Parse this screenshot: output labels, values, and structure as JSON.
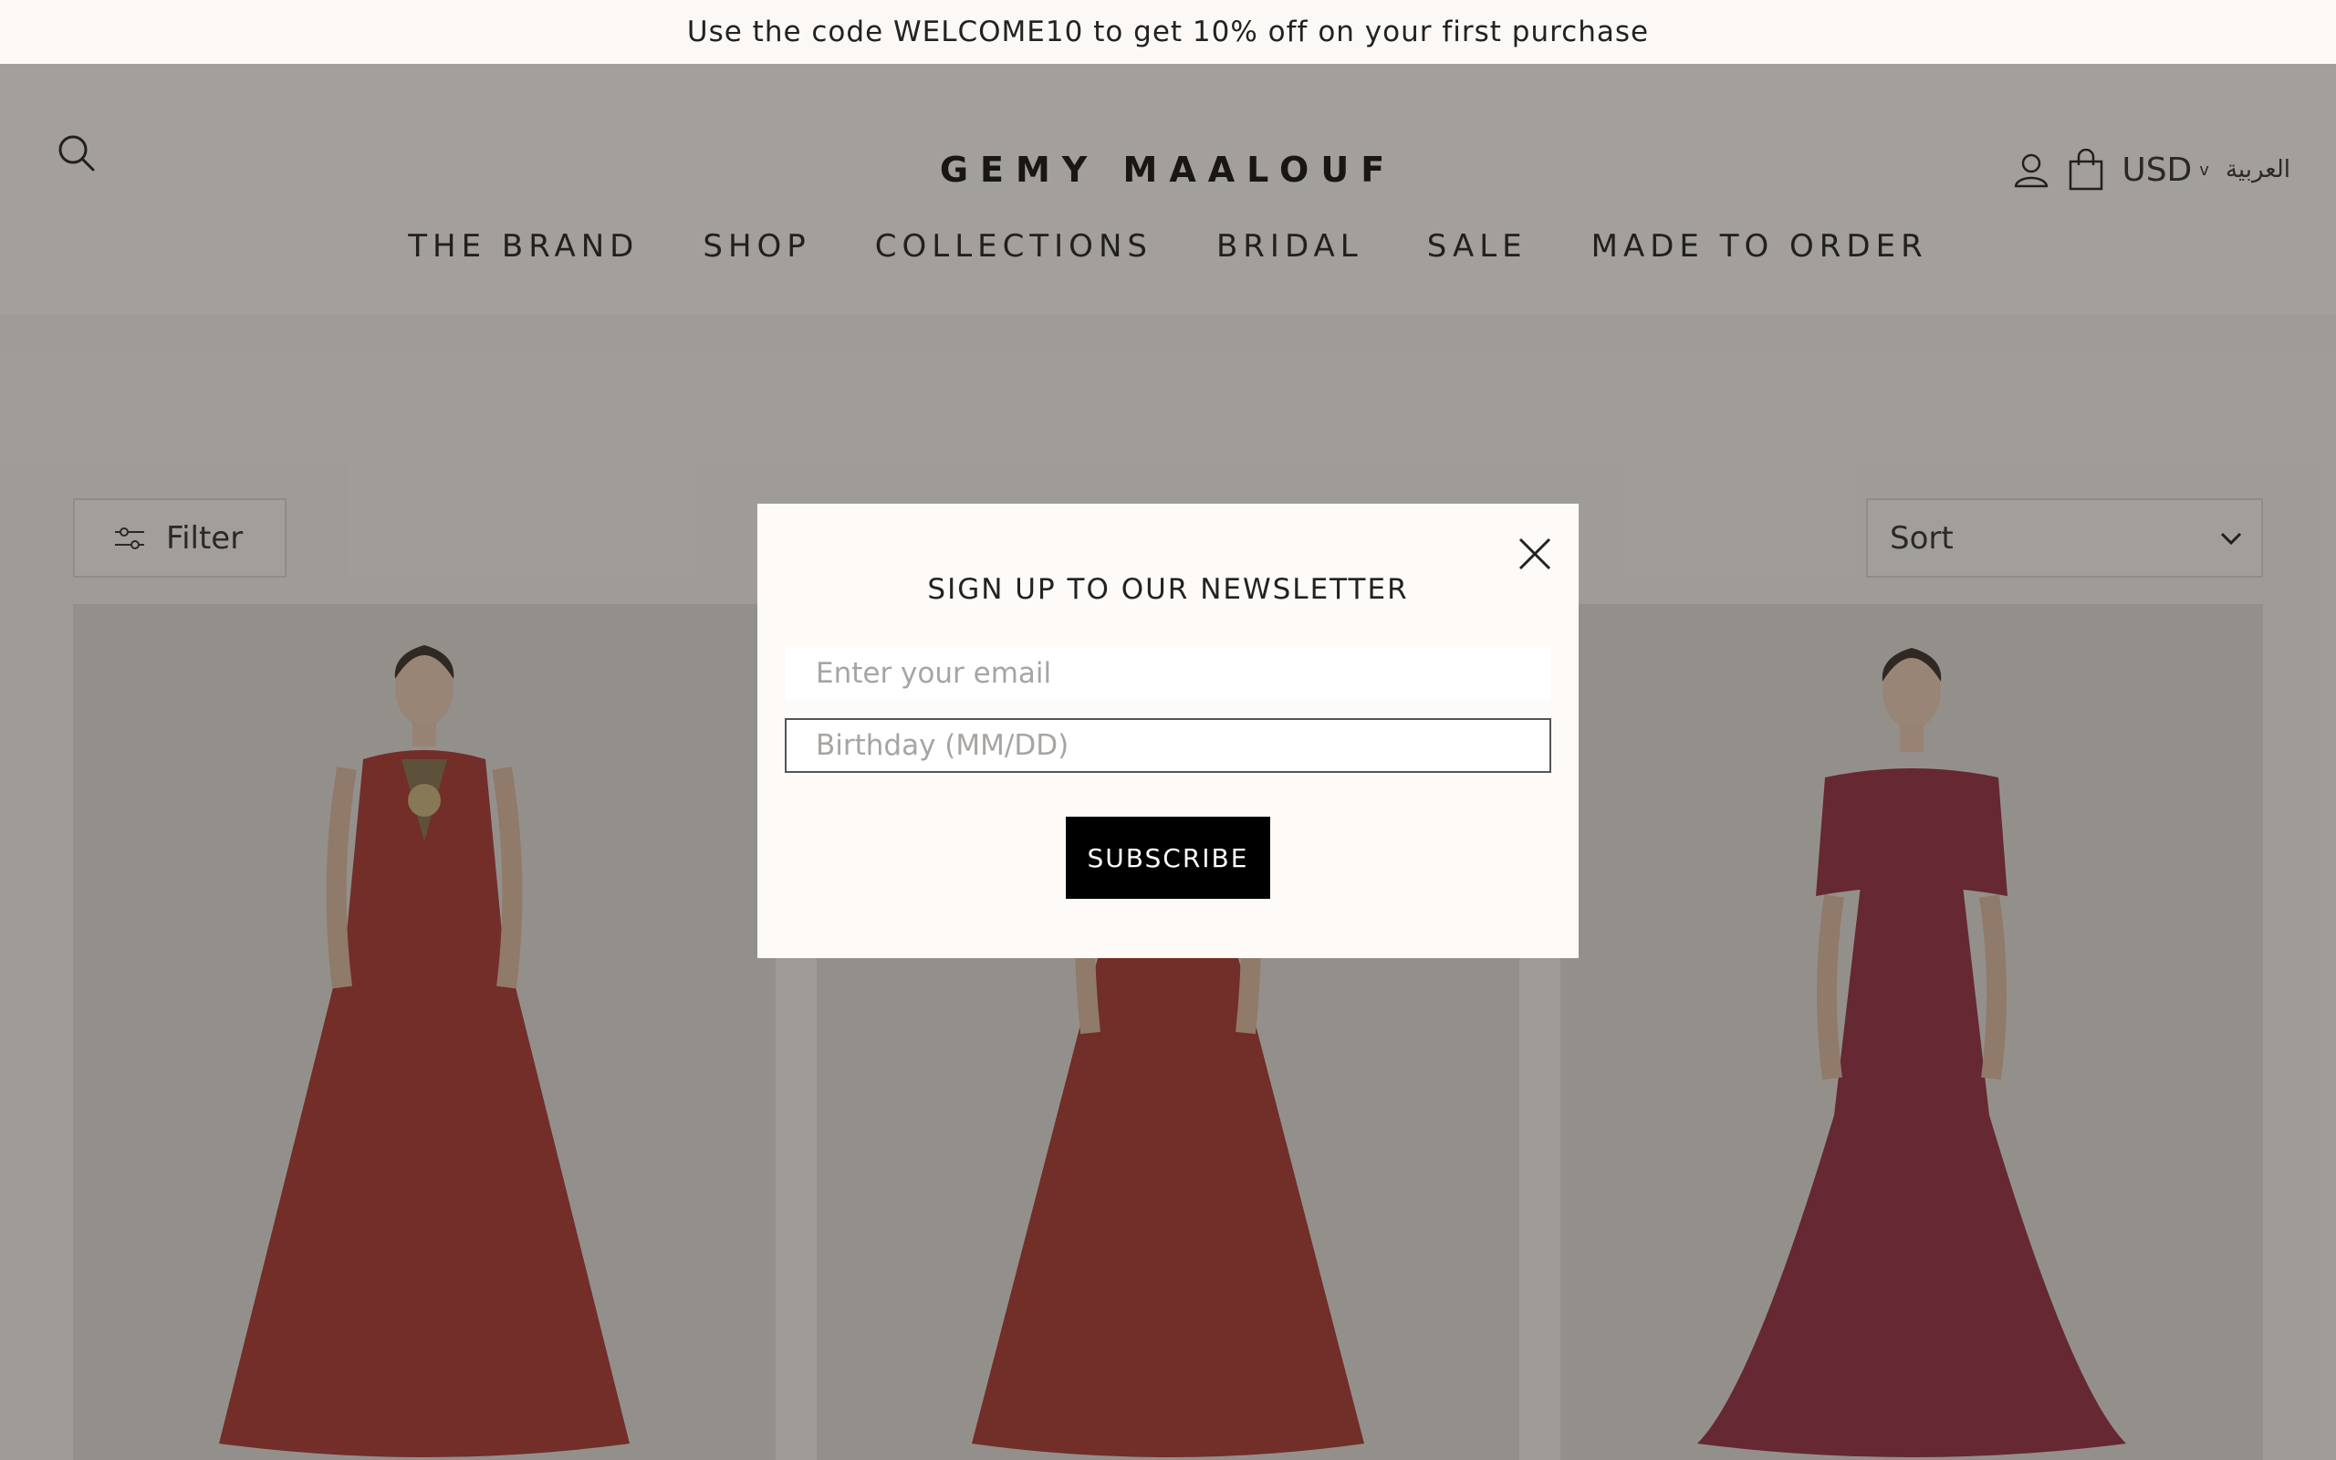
{
  "announcement": "Use the code WELCOME10 to get 10% off on your first purchase",
  "header": {
    "logo": "GEMY MAALOUF",
    "currency": "USD",
    "language": "العربية",
    "nav": [
      "THE BRAND",
      "SHOP",
      "COLLECTIONS",
      "BRIDAL",
      "SALE",
      "MADE TO ORDER"
    ]
  },
  "toolbar": {
    "filter_label": "Filter",
    "sort_label": "Sort"
  },
  "products": [
    {
      "gown_color": "#a52b27",
      "accent": "embellished bodice"
    },
    {
      "gown_color": "#a32a26",
      "accent": "pleated"
    },
    {
      "gown_color": "#8c2037",
      "accent": "bow wrap"
    }
  ],
  "modal": {
    "title": "SIGN UP TO OUR NEWSLETTER",
    "email_placeholder": "Enter your email",
    "birthday_placeholder": "Birthday (MM/DD)",
    "subscribe_label": "SUBSCRIBE"
  },
  "icons": {
    "search": "search-icon",
    "account": "account-icon",
    "cart": "shopping-bag-icon",
    "filter": "sliders-icon",
    "sort": "chevron-down-icon",
    "close": "close-icon"
  },
  "colors": {
    "background": "#fbf8f5",
    "overlay": "rgba(55,50,45,0.45)",
    "button": "#000000"
  }
}
